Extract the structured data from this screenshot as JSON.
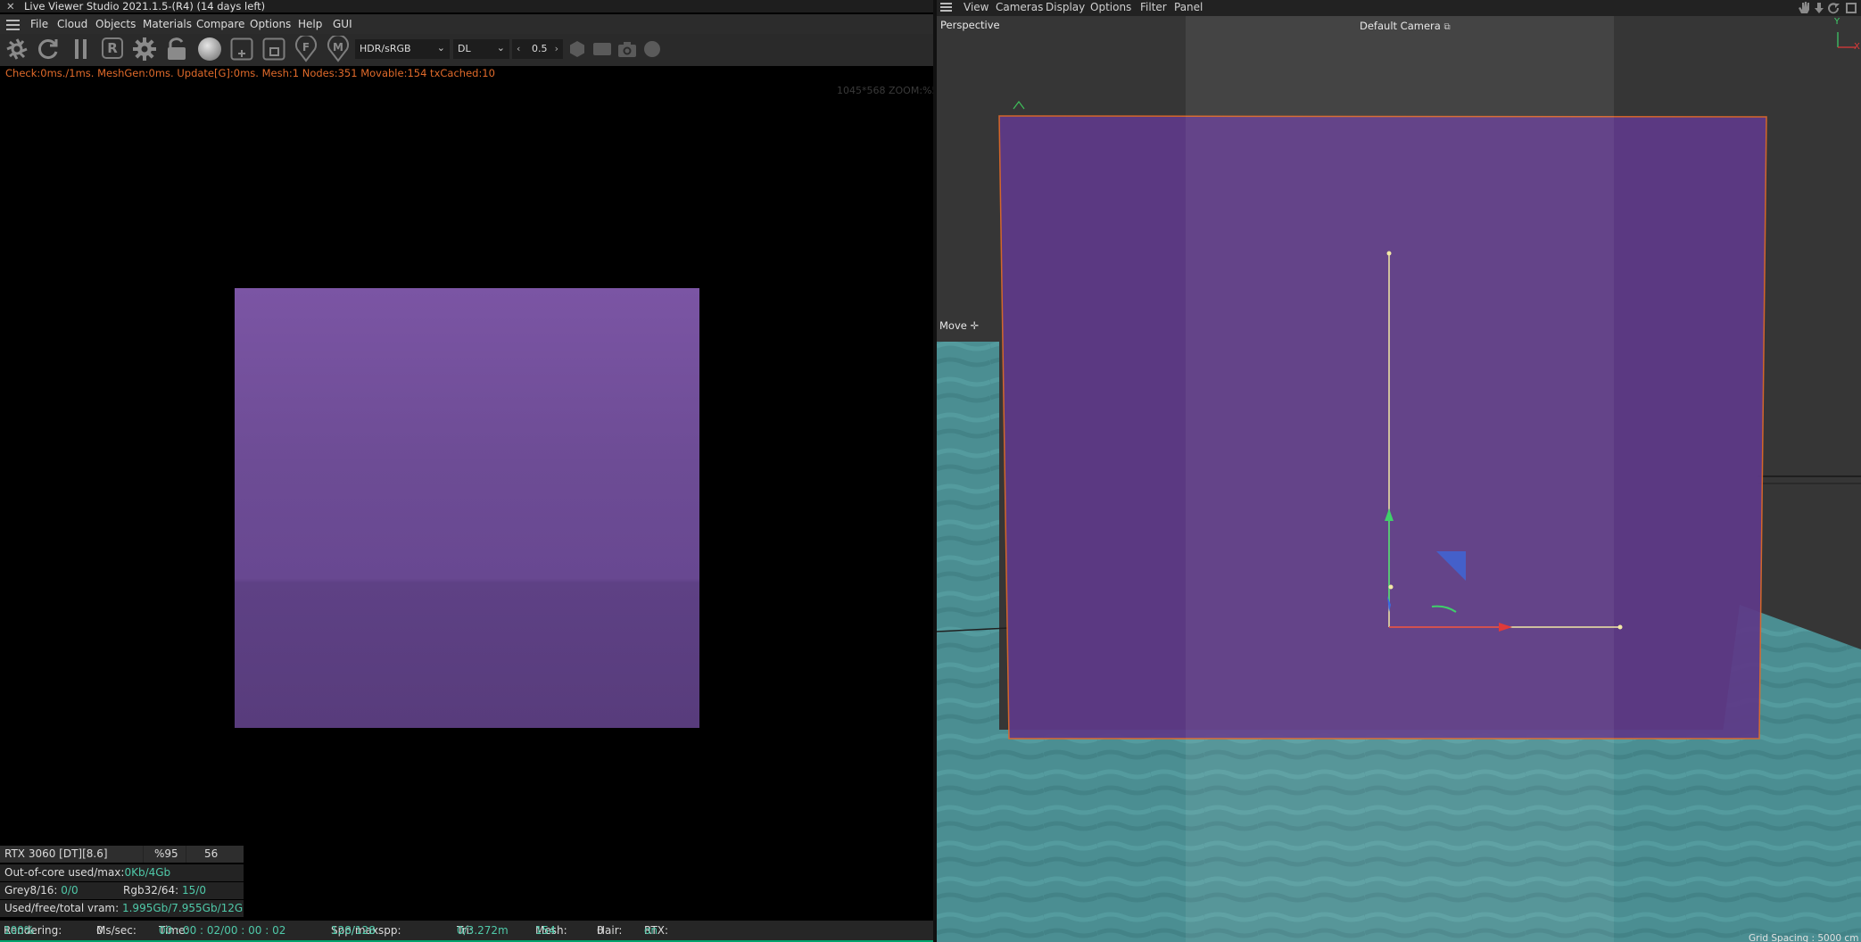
{
  "app": {
    "title": "Live Viewer Studio 2021.1.5-(R4) (14 days left)",
    "menu": [
      "File",
      "Cloud",
      "Objects",
      "Materials",
      "Compare",
      "Options",
      "Help",
      "GUI"
    ]
  },
  "toolbar": {
    "icons": [
      "shutter-icon",
      "refresh-icon",
      "pause-icon",
      "region-render-icon",
      "settings-gear-icon",
      "lock-icon",
      "material-sphere-icon",
      "add-region-icon",
      "focus-region-icon",
      "focus-picker-icon",
      "material-picker-icon",
      "hex-icon",
      "film-icon",
      "camera-icon",
      "circle-icon"
    ],
    "region_label": "R",
    "focus_label": "F",
    "material_label": "M",
    "color_space": "HDR/sRGB",
    "kernel": "DL",
    "value": "0.5"
  },
  "render": {
    "stats": "Check:0ms./1ms. MeshGen:0ms. Update[G]:0ms. Mesh:1 Nodes:351 Movable:154 txCached:10",
    "zoom": "1045*568 ZOOM:%50",
    "square_color": "#6d4c95"
  },
  "gpu": {
    "name": "RTX 3060 [DT][8.6]",
    "load": "%95",
    "temp": "56",
    "out_of_core_label": "Out-of-core used/max:",
    "out_of_core_value": "0Kb/4Gb",
    "grey_label": "Grey8/16:",
    "grey_value": "0/0",
    "rgb_label": "Rgb32/64:",
    "rgb_value": "15/0",
    "vram_label": "Used/free/total vram:",
    "vram_value": "1.995Gb/7.955Gb/12Gb"
  },
  "status": {
    "rendering_label": "Rendering:",
    "rendering_value": "100%",
    "ms_label": "Ms/sec:",
    "ms_value": "0",
    "time_label": "Time:",
    "time_value": "00 : 00 : 02/00 : 00 : 02",
    "spp_label": "Spp/maxspp:",
    "spp_value": "128/128",
    "tri_label": "Tri:",
    "tri_value": "0/3.272m",
    "mesh_label": "Mesh:",
    "mesh_value": "154",
    "hair_label": "Hair:",
    "hair_value": "0",
    "rtx_label": "RTX:",
    "rtx_value": "on"
  },
  "viewport": {
    "menu": [
      "View",
      "Cameras",
      "Display",
      "Options",
      "Filter",
      "Panel"
    ],
    "view_name": "Perspective",
    "camera": "Default Camera",
    "tool": "Move",
    "grid_spacing": "Grid Spacing : 5000 cm",
    "axis_y": "Y",
    "axis_x": "X",
    "header_icons": [
      "pan-icon",
      "dolly-icon",
      "rotate-icon",
      "maximize-icon"
    ]
  }
}
